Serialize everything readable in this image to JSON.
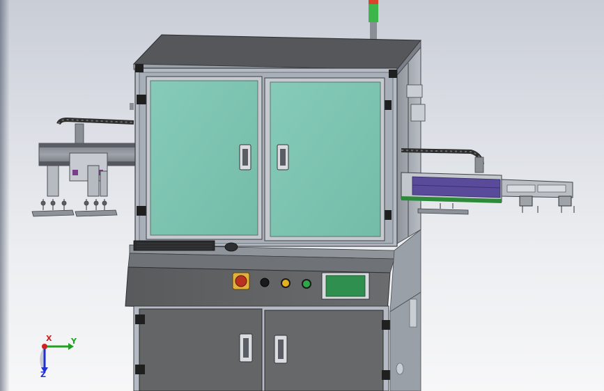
{
  "viewport": {
    "title": ""
  },
  "colors": {
    "background_top": "#c9cdd6",
    "background_bottom": "#f7f7f8",
    "cabinet_body": "#5f6163",
    "cabinet_top": "#4e5052",
    "frame_aluminum": "#b8bec8",
    "glass_panel": "#7ec4b2",
    "drag_chain": "#3a3a3a",
    "conveyor_belt": "#5a4a9a",
    "conveyor_rail": "#2d8a3a",
    "tower_light_red": "#d8432a",
    "tower_light_green": "#3cb54a",
    "hmi_screen": "#2f8f4e",
    "button_yellow": "#e3b21c",
    "button_green": "#2fa84a",
    "axis_x": "#d22020",
    "axis_y": "#20a020",
    "axis_z": "#2030d0"
  },
  "triad": {
    "x_label": "X",
    "y_label": "Y",
    "z_label": "Z"
  },
  "components": {
    "signal_tower": "signal-tower-icon",
    "hmi": "hmi-screen-icon",
    "emergency_stop": "emergency-stop-icon",
    "keyboard": "keyboard-icon"
  }
}
